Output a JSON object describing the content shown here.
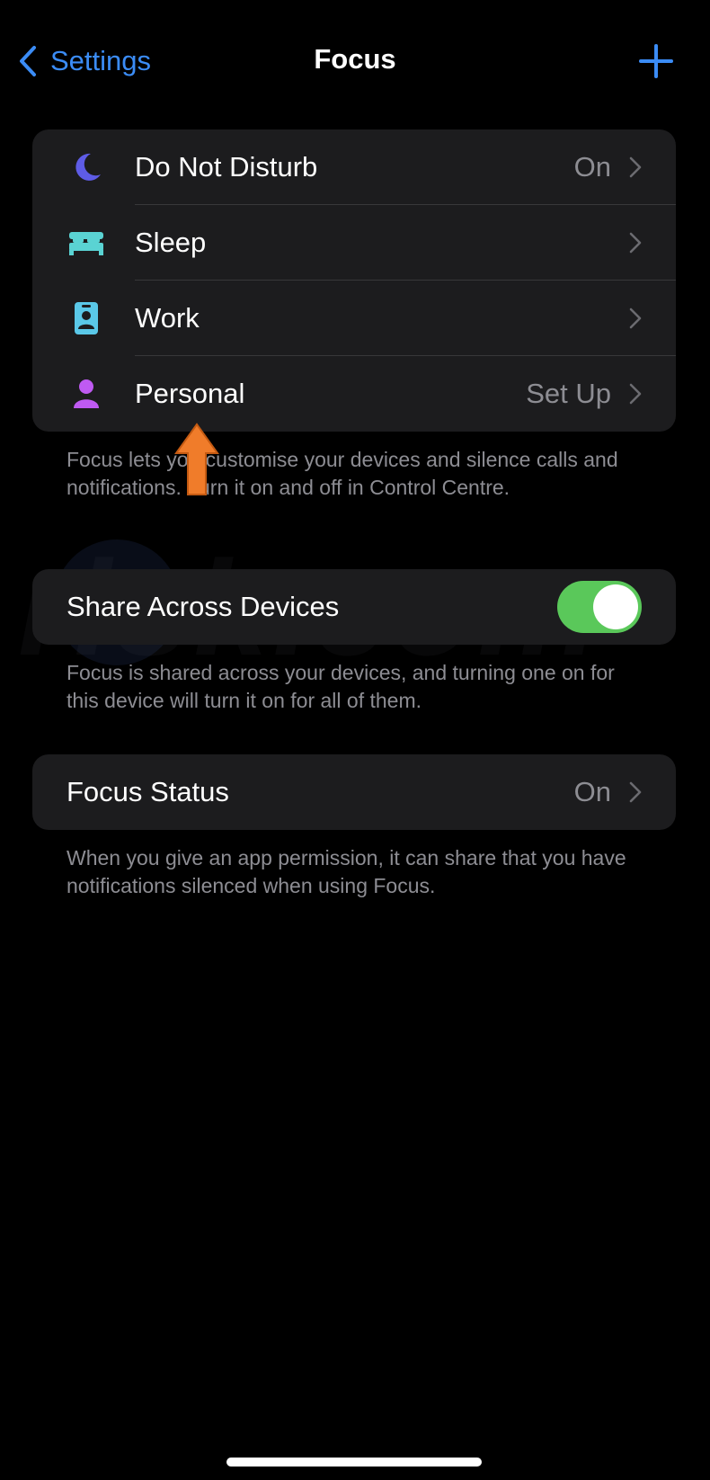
{
  "navbar": {
    "back_label": "Settings",
    "title": "Focus"
  },
  "focus_modes": [
    {
      "label": "Do Not Disturb",
      "value": "On",
      "icon": "moon-icon",
      "icon_color": "#5e5ce6"
    },
    {
      "label": "Sleep",
      "value": "",
      "icon": "bed-icon",
      "icon_color": "#5ad3d3"
    },
    {
      "label": "Work",
      "value": "",
      "icon": "id-badge-icon",
      "icon_color": "#5ac8e8"
    },
    {
      "label": "Personal",
      "value": "Set Up",
      "icon": "person-icon",
      "icon_color": "#bf5af2"
    }
  ],
  "focus_note": "Focus lets you customise your devices and silence calls and notifications. Turn it on and off in Control Centre.",
  "share": {
    "label": "Share Across Devices",
    "toggle_on": true,
    "note": "Focus is shared across your devices, and turning one on for this device will turn it on for all of them."
  },
  "status": {
    "label": "Focus Status",
    "value": "On",
    "note": "When you give an app permission, it can share that you have notifications silenced when using Focus."
  },
  "watermark_text": "risk.com",
  "colors": {
    "accent": "#3b8cf6",
    "toggle_on": "#5ac85a",
    "annotation_arrow": "#f07c2a"
  }
}
